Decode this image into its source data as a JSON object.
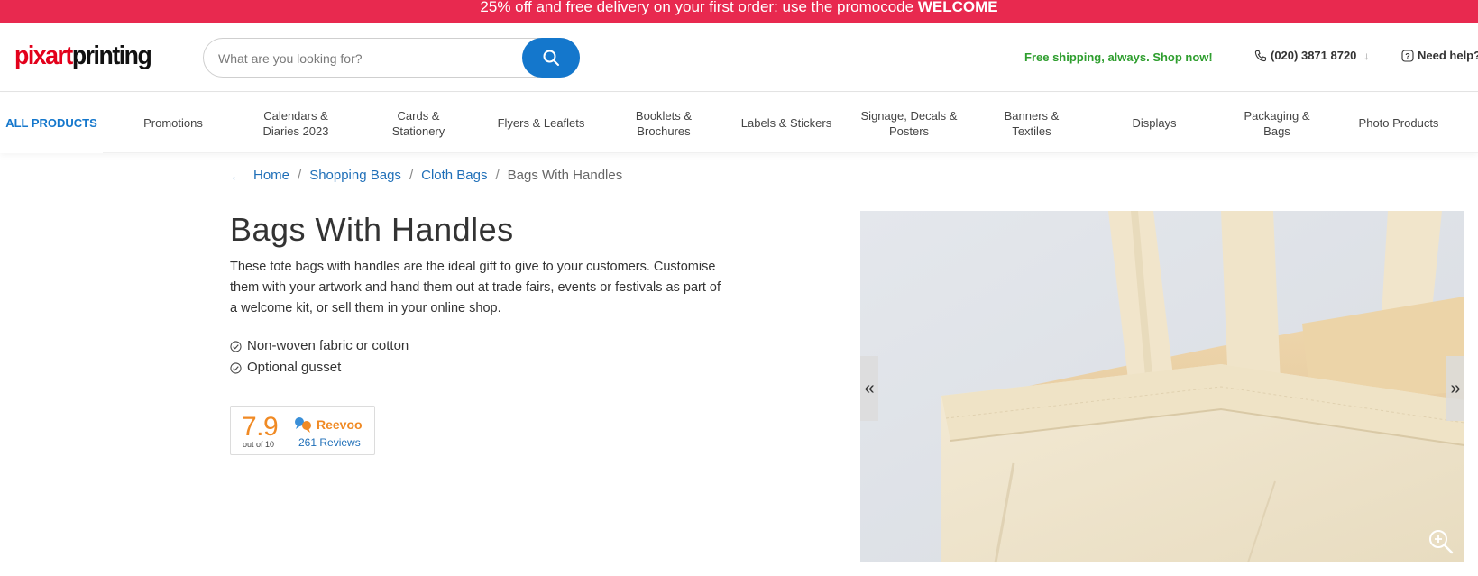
{
  "promo": {
    "text": "25% off and free delivery on your first order: use the promocode ",
    "code": "WELCOME"
  },
  "header": {
    "logo_part1": "pixart",
    "logo_part2": "printing",
    "search_placeholder": "What are you looking for?",
    "shipping_text": "Free shipping, always. Shop now!",
    "phone": "(020) 3871 8720",
    "phone_chevron": "↓",
    "help": "Need help?"
  },
  "nav": {
    "items": [
      {
        "label": "ALL PRODUCTS"
      },
      {
        "label": "Promotions"
      },
      {
        "label": "Calendars & Diaries 2023"
      },
      {
        "label": "Cards & Stationery"
      },
      {
        "label": "Flyers & Leaflets"
      },
      {
        "label": "Booklets & Brochures"
      },
      {
        "label": "Labels & Stickers"
      },
      {
        "label": "Signage, Decals & Posters"
      },
      {
        "label": "Banners & Textiles"
      },
      {
        "label": "Displays"
      },
      {
        "label": "Packaging & Bags"
      },
      {
        "label": "Photo Products"
      }
    ]
  },
  "breadcrumb": {
    "items": [
      "Home",
      "Shopping Bags",
      "Cloth Bags"
    ],
    "current": "Bags With Handles",
    "separator": "/"
  },
  "product": {
    "title": "Bags With Handles",
    "description": "These tote bags with handles are the ideal gift to give to your customers. Customise them with your artwork and hand them out at trade fairs, events or festivals as part of a welcome kit, or sell them in your online shop.",
    "features": [
      "Non-woven fabric or cotton",
      "Optional gusset"
    ]
  },
  "rating": {
    "score": "7.9",
    "out_of": "out of 10",
    "brand": "Reevoo",
    "reviews": "261 Reviews"
  },
  "gallery": {
    "prev": "«",
    "next": "»"
  },
  "colors": {
    "promo_bg": "#e8294f",
    "brand_blue": "#1477cc",
    "logo_red": "#e3001b",
    "shipping_green": "#2e9e2e",
    "rating_orange": "#f08a24"
  }
}
